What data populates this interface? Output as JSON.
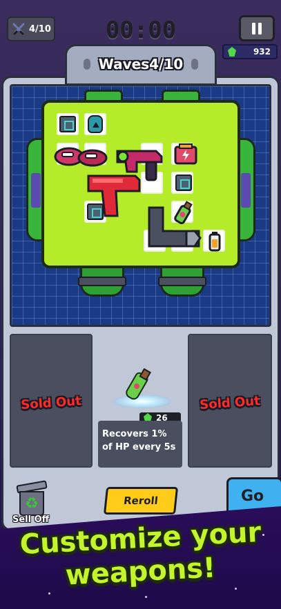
{
  "hud": {
    "wave_counter": "4/10",
    "timer": "00:00",
    "gems": "932"
  },
  "machine": {
    "title": "Waves4/10"
  },
  "shop": {
    "left_card_status": "Sold Out",
    "right_card_status": "Sold Out",
    "item_price": "26",
    "item_description": "Recovers 1% of HP every 5s"
  },
  "controls": {
    "sell_label": "Sell Off",
    "reroll_label": "Reroll",
    "go_label": "Go"
  },
  "promo": {
    "line1": "Customize your",
    "line2": "weapons!"
  },
  "colors": {
    "board": "#b4ec2a",
    "grid_panel": "#1b3a86",
    "gem": "#53d64a",
    "sold_out": "#ff2a2a",
    "reroll": "#ffcc1a",
    "go": "#3fb0f0"
  }
}
